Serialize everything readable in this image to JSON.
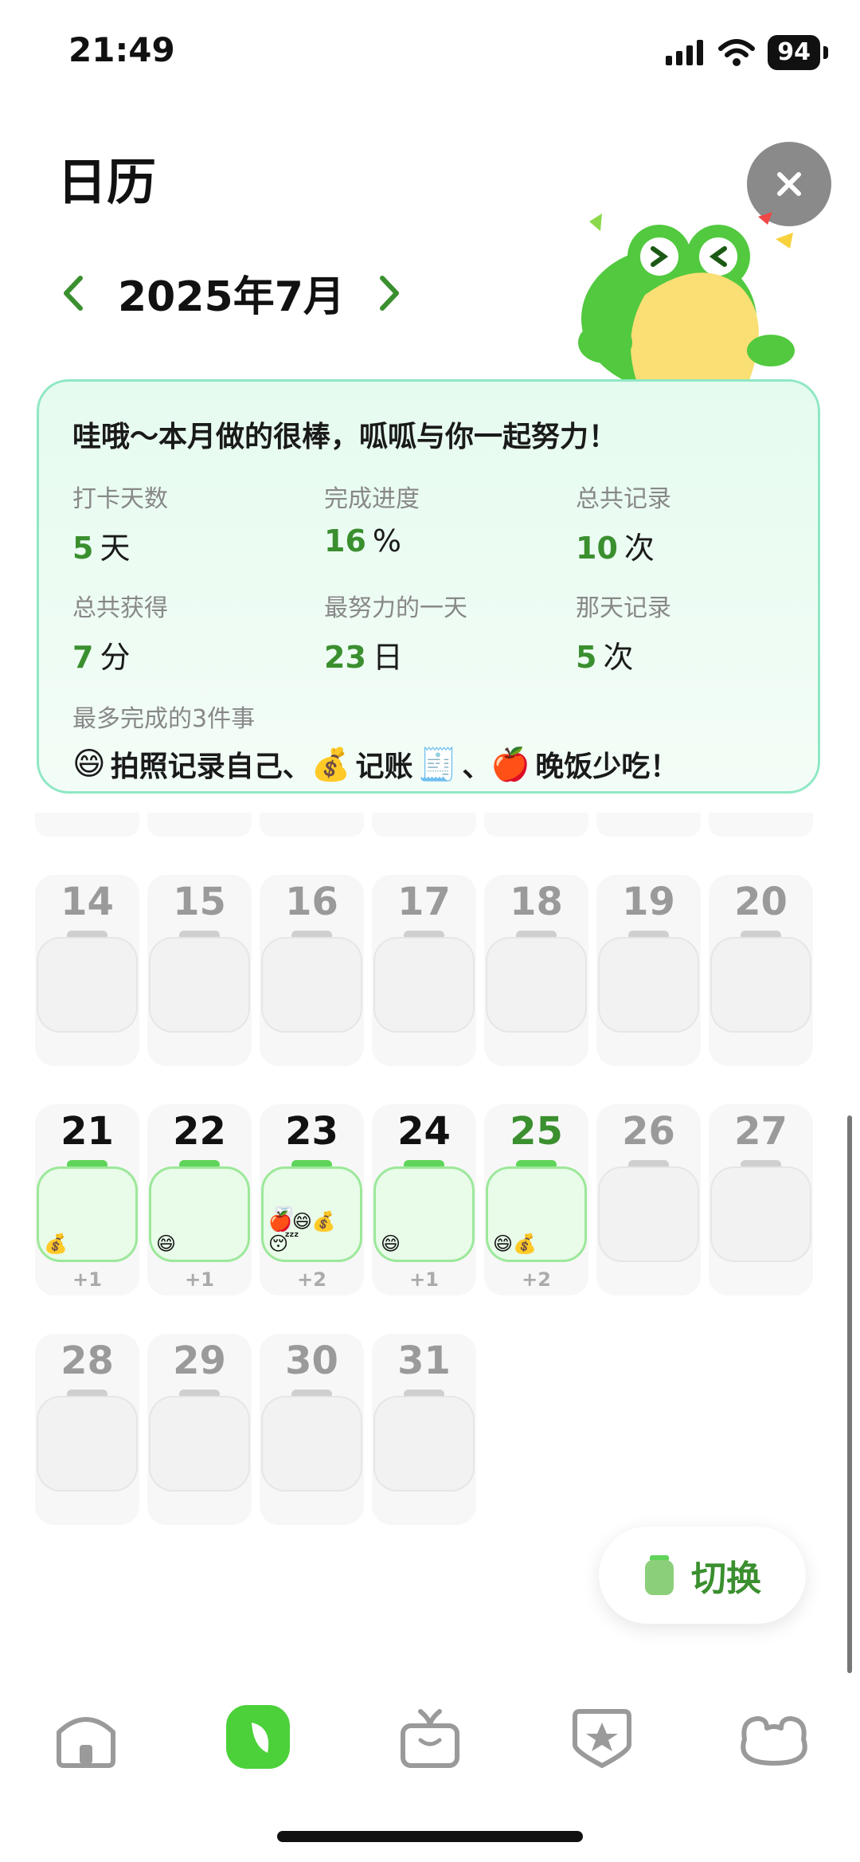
{
  "status": {
    "time": "21:49",
    "battery": "94"
  },
  "header": {
    "title": "日历",
    "month": "2025年7月"
  },
  "summary": {
    "headline": "哇哦～本月做的很棒，呱呱与你一起努力！",
    "stats": [
      {
        "label": "打卡天数",
        "num": "5",
        "unit": "天"
      },
      {
        "label": "完成进度",
        "num": "16",
        "unit": "%"
      },
      {
        "label": "总共记录",
        "num": "10",
        "unit": "次"
      },
      {
        "label": "总共获得",
        "num": "7",
        "unit": "分"
      },
      {
        "label": "最努力的一天",
        "num": "23",
        "unit": "日"
      },
      {
        "label": "那天记录",
        "num": "5",
        "unit": "次"
      }
    ],
    "top3_label": "最多完成的3件事",
    "top3": [
      {
        "emoji": "😄",
        "text": "拍照记录自己"
      },
      {
        "sep": "、"
      },
      {
        "emoji": "💰",
        "text": "记账"
      },
      {
        "emoji2": "🧾"
      },
      {
        "sep2": "、"
      },
      {
        "emoji": "🍎",
        "text": "晚饭少吃！"
      }
    ]
  },
  "calendar": {
    "weeks": [
      [
        {
          "day": "14",
          "state": "empty"
        },
        {
          "day": "15",
          "state": "empty"
        },
        {
          "day": "16",
          "state": "empty"
        },
        {
          "day": "17",
          "state": "empty"
        },
        {
          "day": "18",
          "state": "empty"
        },
        {
          "day": "19",
          "state": "empty"
        },
        {
          "day": "20",
          "state": "empty"
        }
      ],
      [
        {
          "day": "21",
          "state": "active",
          "emojis": "💰",
          "extra": "",
          "plus": "+1"
        },
        {
          "day": "22",
          "state": "active",
          "emojis": "😄",
          "extra": "",
          "plus": "+1"
        },
        {
          "day": "23",
          "state": "active",
          "emojis": "🍎😄💰😴",
          "extra": "🦷",
          "plus": "+2"
        },
        {
          "day": "24",
          "state": "active",
          "emojis": "😄",
          "extra": "",
          "plus": "+1"
        },
        {
          "day": "25",
          "state": "today",
          "emojis": "😄💰",
          "extra": "",
          "plus": "+2"
        },
        {
          "day": "26",
          "state": "empty"
        },
        {
          "day": "27",
          "state": "empty"
        }
      ],
      [
        {
          "day": "28",
          "state": "empty"
        },
        {
          "day": "29",
          "state": "empty"
        },
        {
          "day": "30",
          "state": "empty"
        },
        {
          "day": "31",
          "state": "empty"
        }
      ]
    ]
  },
  "switch_button": {
    "label": "切换"
  },
  "nav": [
    "home-icon",
    "leaf-icon",
    "gift-icon",
    "badge-star-icon",
    "frog-icon"
  ],
  "colors": {
    "accent": "#3a8f2e",
    "green": "#5fd45a",
    "card_border": "#8fe8c4"
  }
}
